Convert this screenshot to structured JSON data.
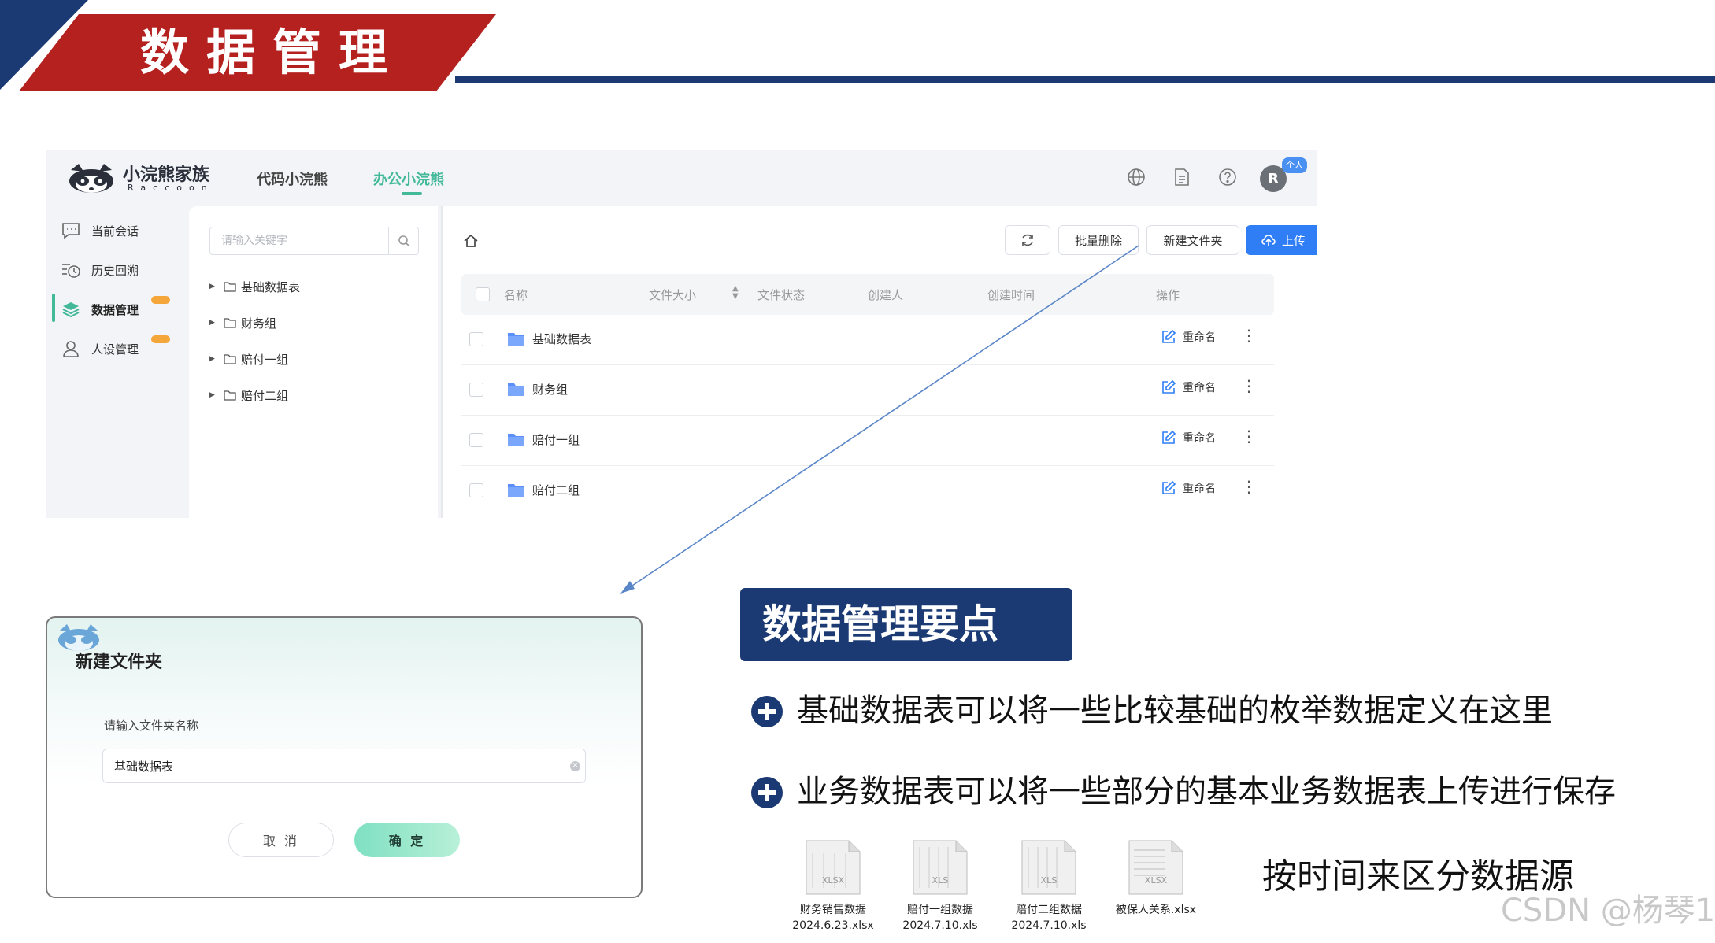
{
  "slide": {
    "title": "数据管理",
    "key_points_title": "数据管理要点",
    "bullets": [
      "基础数据表可以将一些比较基础的枚举数据定义在这里",
      "业务数据表可以将一些部分的基本业务数据表上传进行保存"
    ],
    "side_note": "按时间来区分数据源",
    "watermark": "CSDN @杨琴1",
    "files": [
      {
        "name": "财务销售数据",
        "file": "2024.6.23.xlsx",
        "ext": "XLSX"
      },
      {
        "name": "赔付一组数据",
        "file": "2024.7.10.xls",
        "ext": "XLS"
      },
      {
        "name": "赔付二组数据",
        "file": "2024.7.10.xls",
        "ext": "XLS"
      },
      {
        "name": "被保人关系.xlsx",
        "file": "",
        "ext": "XLSX"
      }
    ]
  },
  "app": {
    "brand": {
      "name": "小浣熊家族",
      "sub": "Raccoon"
    },
    "nav_tabs": [
      {
        "label": "代码小浣熊",
        "active": false
      },
      {
        "label": "办公小浣熊",
        "active": true
      }
    ],
    "user": {
      "initial": "R",
      "badge": "个人"
    },
    "sidebar": {
      "items": [
        {
          "label": "当前会话",
          "icon": "chat-icon",
          "active": false,
          "badge": false
        },
        {
          "label": "历史回溯",
          "icon": "history-icon",
          "active": false,
          "badge": false
        },
        {
          "label": "数据管理",
          "icon": "layers-icon",
          "active": true,
          "badge": true
        },
        {
          "label": "人设管理",
          "icon": "user-icon",
          "active": false,
          "badge": true
        }
      ]
    },
    "search": {
      "placeholder": "请输入关键字",
      "value": ""
    },
    "tree": [
      "基础数据表",
      "财务组",
      "赔付一组",
      "赔付二组"
    ],
    "toolbar": {
      "batch_delete": "批量删除",
      "new_folder": "新建文件夹",
      "upload": "上传"
    },
    "table": {
      "columns": [
        "名称",
        "文件大小",
        "文件状态",
        "创建人",
        "创建时间",
        "操作"
      ],
      "rows": [
        {
          "name": "基础数据表",
          "action": "重命名"
        },
        {
          "name": "财务组",
          "action": "重命名"
        },
        {
          "name": "赔付一组",
          "action": "重命名"
        },
        {
          "name": "赔付二组",
          "action": "重命名"
        }
      ]
    }
  },
  "dialog": {
    "title": "新建文件夹",
    "label": "请输入文件夹名称",
    "input_value": "基础数据表",
    "cancel": "取 消",
    "ok": "确 定"
  },
  "colors": {
    "navy": "#1b3a73",
    "red": "#b4211f",
    "accent_green": "#43b99a",
    "primary_blue": "#2f7ef6"
  }
}
